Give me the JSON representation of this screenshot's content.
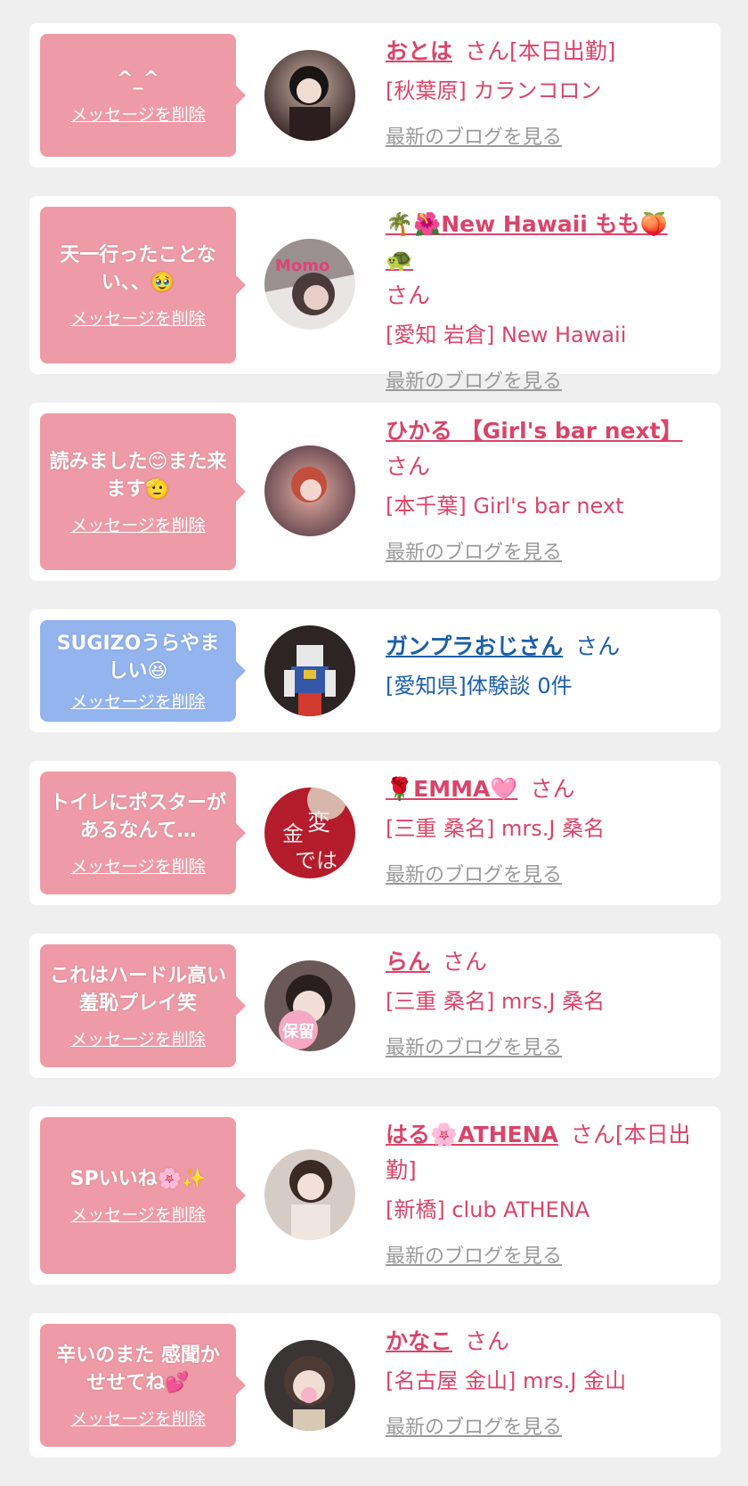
{
  "delete_label": "メッセージを削除",
  "blog_label": "最新のブログを見る",
  "san_label": "さん",
  "colors": {
    "pink_bubble": "#ee9ba7",
    "blue_bubble": "#93b4ee",
    "pink_text": "#d9456a",
    "blue_text": "#1c5fa8",
    "link_gray": "#9a9a9a",
    "background": "#efefef"
  },
  "items": [
    {
      "message": "^_^",
      "name": "おとは",
      "san": "さん[本日出勤]",
      "shop": "[秋葉原] カランコロン",
      "has_blog": true
    },
    {
      "message": "天一行ったことない、、🥹",
      "name": "🌴🌺New Hawaii もも🍑🐢",
      "san": "さん",
      "shop": "[愛知 岩倉] New Hawaii",
      "has_blog": true
    },
    {
      "message": "読みました😊また来ます🫡",
      "name": "ひかる 【Girl's bar next】",
      "san": "さん",
      "shop": "[本千葉] Girl's bar next",
      "has_blog": true
    },
    {
      "message": "SUGIZOうらやましい😆",
      "name": "ガンプラおじさん",
      "san": "さん",
      "shop": "[愛知県]体験談 0件",
      "has_blog": false
    },
    {
      "message": "トイレにポスターがあるなんて…",
      "name": "🌹EMMA🩷",
      "san": "さん",
      "shop": "[三重 桑名] mrs.J 桑名",
      "has_blog": true
    },
    {
      "message": "これはハードル高い羞恥プレイ笑",
      "name": "らん",
      "san": "さん",
      "shop": "[三重 桑名] mrs.J 桑名",
      "has_blog": true
    },
    {
      "message": "SPいいね🌸✨",
      "name": "はる🌸ATHENA",
      "san": "さん[本日出勤]",
      "shop": "[新橋] club ATHENA",
      "has_blog": true
    },
    {
      "message": "辛いのまた 感聞かせせてね💕",
      "name": "かなこ",
      "san": "さん",
      "shop": "[名古屋 金山] mrs.J 金山",
      "has_blog": true
    }
  ]
}
